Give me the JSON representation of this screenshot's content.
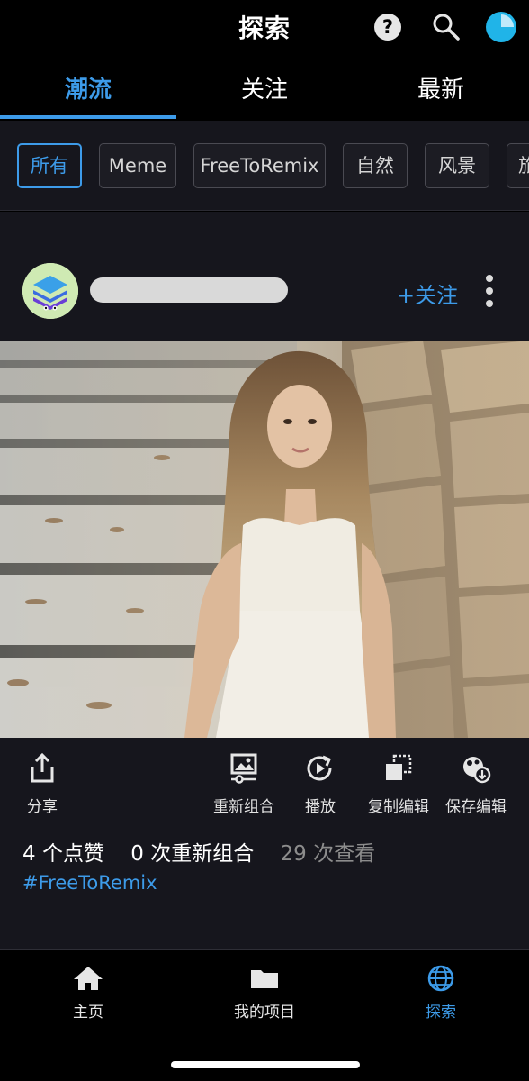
{
  "header": {
    "title": "探索",
    "help_icon_glyph": "?",
    "accent_color": "#3d9be9"
  },
  "tabs": [
    {
      "label": "潮流",
      "active": true
    },
    {
      "label": "关注",
      "active": false
    },
    {
      "label": "最新",
      "active": false
    }
  ],
  "filters": [
    {
      "label": "所有",
      "active": true
    },
    {
      "label": "Meme",
      "active": false
    },
    {
      "label": "FreeToRemix",
      "active": false
    },
    {
      "label": "自然",
      "active": false
    },
    {
      "label": "风景",
      "active": false
    },
    {
      "label": "旅",
      "active": false
    }
  ],
  "post": {
    "follow_label": "+关注",
    "photo_icon": "photo-of-woman-on-stone-stairs",
    "actions": [
      {
        "label": "分享",
        "icon": "share-icon"
      },
      {
        "label": "重新组合",
        "icon": "remix-icon"
      },
      {
        "label": "播放",
        "icon": "replay-icon"
      },
      {
        "label": "复制编辑",
        "icon": "copy-edits-icon"
      },
      {
        "label": "保存编辑",
        "icon": "save-edits-icon"
      }
    ],
    "stats": {
      "likes": "4 个点赞",
      "remixes": "0 次重新组合",
      "views": "29 次查看"
    },
    "hashtag": "#FreeToRemix"
  },
  "bottom_nav": [
    {
      "label": "主页",
      "icon": "home-icon",
      "active": false
    },
    {
      "label": "我的项目",
      "icon": "folder-icon",
      "active": false
    },
    {
      "label": "探索",
      "icon": "globe-icon",
      "active": true
    }
  ]
}
